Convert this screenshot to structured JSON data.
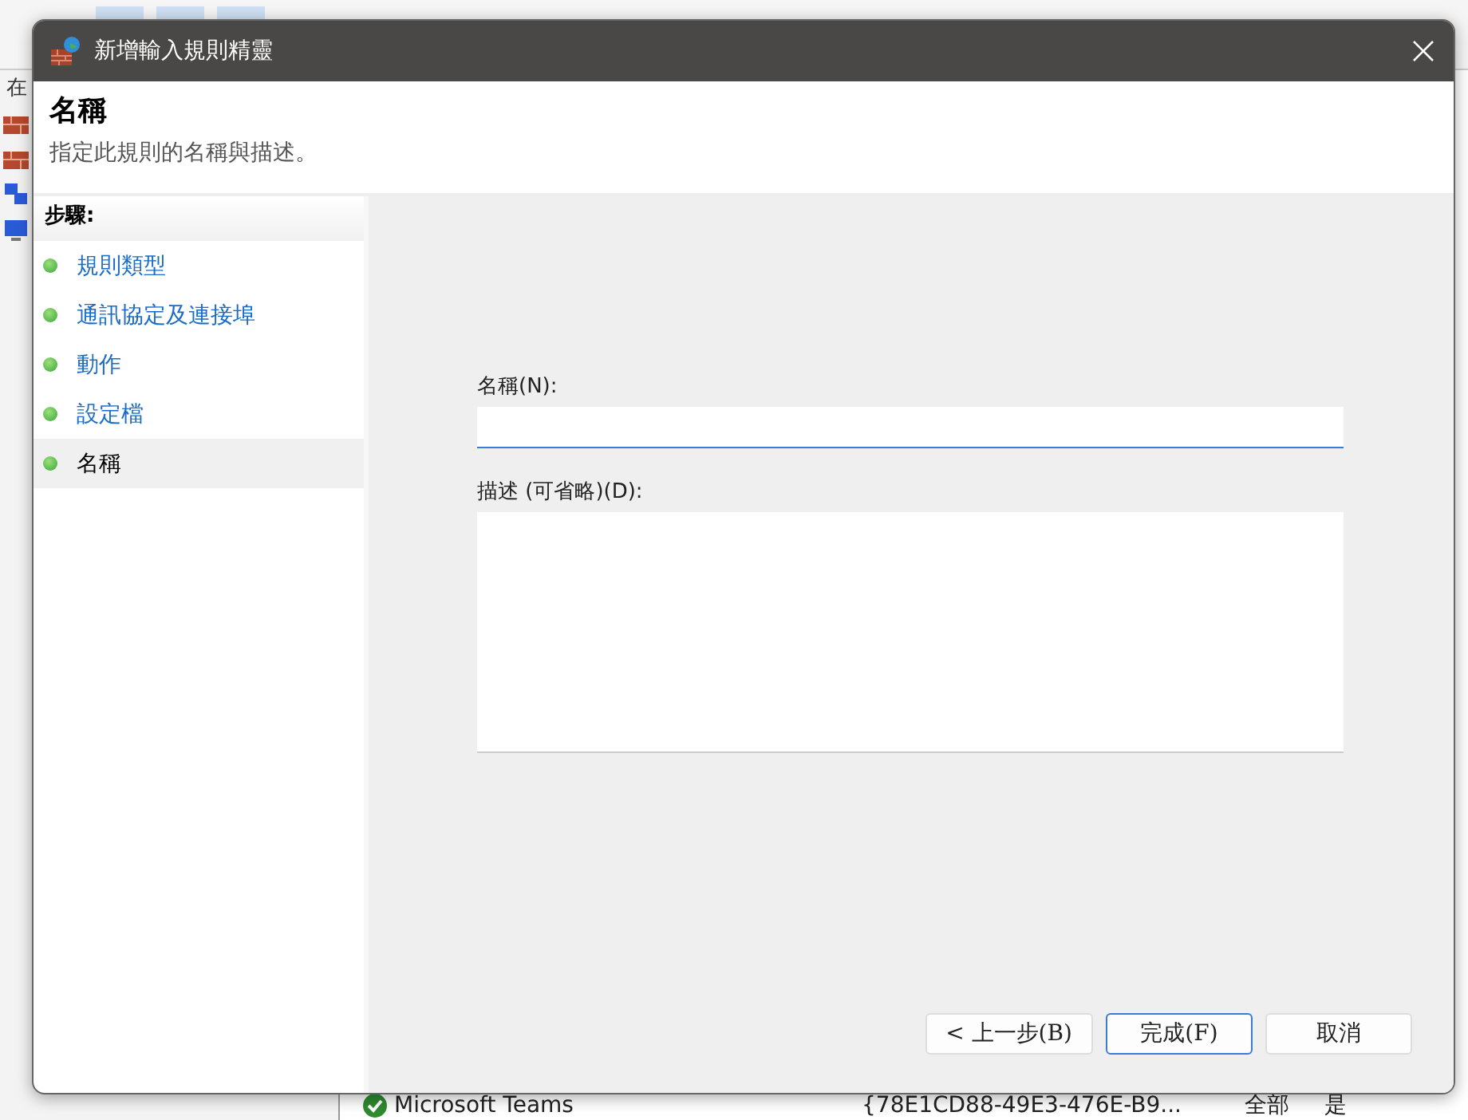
{
  "background_window": {
    "left_label": "在",
    "list_row": {
      "name": "Microsoft Teams",
      "id": "{78E1CD88-49E3-476E-B9...",
      "profile": "全部",
      "enabled": "是"
    }
  },
  "dialog": {
    "title": "新增輸入規則精靈",
    "header": {
      "title": "名稱",
      "subtitle": "指定此規則的名稱與描述。"
    },
    "steps_heading": "步驟:",
    "steps": [
      {
        "label": "規則類型",
        "selected": false
      },
      {
        "label": "通訊協定及連接埠",
        "selected": false
      },
      {
        "label": "動作",
        "selected": false
      },
      {
        "label": "設定檔",
        "selected": false
      },
      {
        "label": "名稱",
        "selected": true
      }
    ],
    "fields": [
      {
        "label": "名稱(N):",
        "kind": "line"
      },
      {
        "label": "描述 (可省略)(D):",
        "kind": "area"
      }
    ],
    "buttons": [
      {
        "label": "< 上一步(B)",
        "default": false
      },
      {
        "label": "完成(F)",
        "default": true
      },
      {
        "label": "取消",
        "default": false
      }
    ]
  }
}
